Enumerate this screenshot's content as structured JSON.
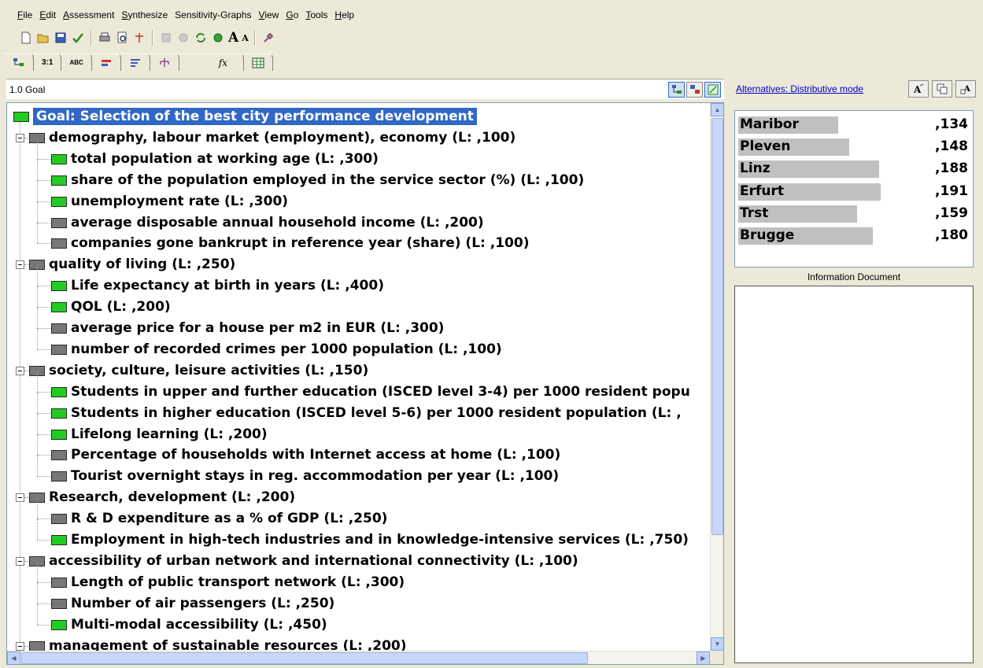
{
  "menu": [
    {
      "label": "File",
      "key": "F",
      "rest": "ile"
    },
    {
      "label": "Edit",
      "key": "E",
      "rest": "dit"
    },
    {
      "label": "Assessment",
      "key": "A",
      "rest": "ssessment"
    },
    {
      "label": "Synthesize",
      "key": "S",
      "rest": "ynthesize"
    },
    {
      "label": "Sensitivity-Graphs",
      "key": "",
      "rest": "Sensitivity-Graphs"
    },
    {
      "label": "View",
      "key": "V",
      "rest": "iew"
    },
    {
      "label": "Go",
      "key": "G",
      "rest": "o"
    },
    {
      "label": "Tools",
      "key": "T",
      "rest": "ools"
    },
    {
      "label": "Help",
      "key": "H",
      "rest": "elp"
    }
  ],
  "toolbar2": {
    "ratio_label": "3:1",
    "abc_label": "ABC",
    "fx_label": "fx"
  },
  "left_header": {
    "title": "1.0 Goal"
  },
  "tree": [
    {
      "text": "Goal: Selection of the best city performance development",
      "level": 0,
      "color": "green",
      "selected": true
    },
    {
      "text": "demography, labour market (employment), economy (L: ,100)",
      "level": 1,
      "color": "gray"
    },
    {
      "text": "total population at working age (L: ,300)",
      "level": 2,
      "color": "green"
    },
    {
      "text": "share of the population employed in the service sector (%) (L: ,100)",
      "level": 2,
      "color": "green"
    },
    {
      "text": "unemployment rate (L: ,300)",
      "level": 2,
      "color": "green"
    },
    {
      "text": "average disposable annual household income (L: ,200)",
      "level": 2,
      "color": "gray"
    },
    {
      "text": "companies gone bankrupt in reference year (share) (L: ,100)",
      "level": 2,
      "color": "gray"
    },
    {
      "text": "quality of living (L: ,250)",
      "level": 1,
      "color": "gray"
    },
    {
      "text": "Life expectancy at birth in years (L: ,400)",
      "level": 2,
      "color": "green"
    },
    {
      "text": "QOL (L: ,200)",
      "level": 2,
      "color": "green"
    },
    {
      "text": "average price for a house per m2 in EUR (L: ,300)",
      "level": 2,
      "color": "gray"
    },
    {
      "text": "number of recorded crimes per 1000 population (L: ,100)",
      "level": 2,
      "color": "gray"
    },
    {
      "text": "society, culture, leisure activities (L: ,150)",
      "level": 1,
      "color": "gray"
    },
    {
      "text": "Students in upper and further education (ISCED level 3-4) per 1000 resident popu",
      "level": 2,
      "color": "green"
    },
    {
      "text": "Students in higher education (ISCED level 5-6) per 1000  resident population (L: ,",
      "level": 2,
      "color": "green"
    },
    {
      "text": "Lifelong learning (L: ,200)",
      "level": 2,
      "color": "green"
    },
    {
      "text": "Percentage of households with Internet access at home (L: ,100)",
      "level": 2,
      "color": "gray"
    },
    {
      "text": "Tourist overnight stays in reg. accommodation per year (L: ,100)",
      "level": 2,
      "color": "gray"
    },
    {
      "text": "Research, development (L: ,200)",
      "level": 1,
      "color": "gray"
    },
    {
      "text": "R & D expenditure as a % of GDP (L: ,250)",
      "level": 2,
      "color": "gray"
    },
    {
      "text": "Employment in high-tech industries and in knowledge-intensive services (L: ,750)",
      "level": 2,
      "color": "green"
    },
    {
      "text": "accessibility of urban network and international  connectivity (L: ,100)",
      "level": 1,
      "color": "gray"
    },
    {
      "text": "Length of public transport network (L: ,300)",
      "level": 2,
      "color": "gray"
    },
    {
      "text": "Number of air passengers (L: ,250)",
      "level": 2,
      "color": "gray"
    },
    {
      "text": "Multi-modal accessibility (L: ,450)",
      "level": 2,
      "color": "green"
    },
    {
      "text": "management of sustainable resources (L: ,200)",
      "level": 1,
      "color": "gray"
    }
  ],
  "right_header": {
    "mode_link": "Alternatives: Distributive mode"
  },
  "alternatives": [
    {
      "name": "Maribor",
      "value": ",134",
      "fraction": 0.134
    },
    {
      "name": "Pleven",
      "value": ",148",
      "fraction": 0.148
    },
    {
      "name": "Linz",
      "value": ",188",
      "fraction": 0.188
    },
    {
      "name": "Erfurt",
      "value": ",191",
      "fraction": 0.191
    },
    {
      "name": "Trst",
      "value": ",159",
      "fraction": 0.159
    },
    {
      "name": "Brugge",
      "value": ",180",
      "fraction": 0.18
    }
  ],
  "info_title": "Information Document",
  "colors": {
    "priority_green": "#22cc22",
    "priority_gray": "#777777",
    "selection_blue": "#3168c5",
    "link_blue": "#0000cc"
  }
}
